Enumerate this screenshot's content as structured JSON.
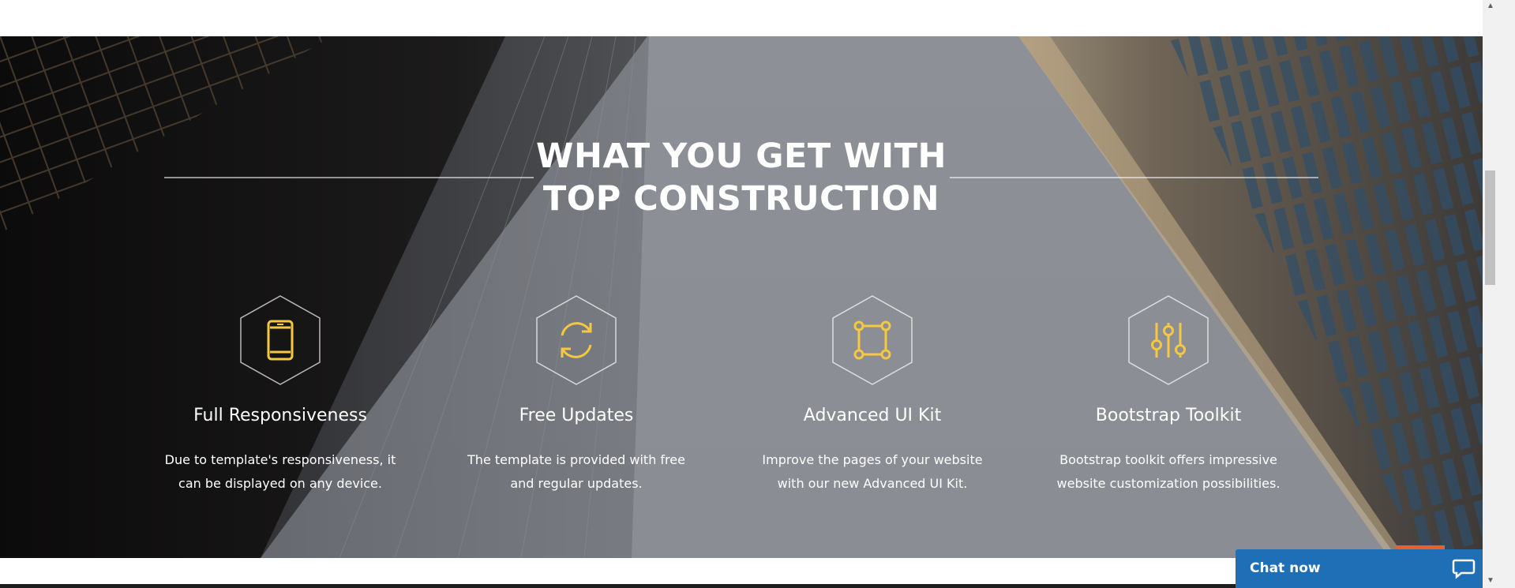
{
  "section": {
    "title_line1": "WHAT YOU GET WITH",
    "title_line2": "TOP CONSTRUCTION"
  },
  "features": [
    {
      "icon": "smartphone-icon",
      "title": "Full Responsiveness",
      "desc_line1": "Due to template's responsiveness, it",
      "desc_line2": "can be displayed on any device."
    },
    {
      "icon": "refresh-icon",
      "title": "Free Updates",
      "desc_line1": "The template is provided with free",
      "desc_line2": "and regular updates."
    },
    {
      "icon": "vector-square-icon",
      "title": "Advanced UI Kit",
      "desc_line1": "Improve the pages of your website",
      "desc_line2": "with our new Advanced UI Kit."
    },
    {
      "icon": "sliders-icon",
      "title": "Bootstrap Toolkit",
      "desc_line1": "Bootstrap toolkit offers impressive",
      "desc_line2": "website customization possibilities."
    }
  ],
  "chat": {
    "label": "Chat now"
  },
  "colors": {
    "accent": "#f5c842",
    "chat_blue": "#1f6fb7",
    "orange": "#e8602c"
  }
}
